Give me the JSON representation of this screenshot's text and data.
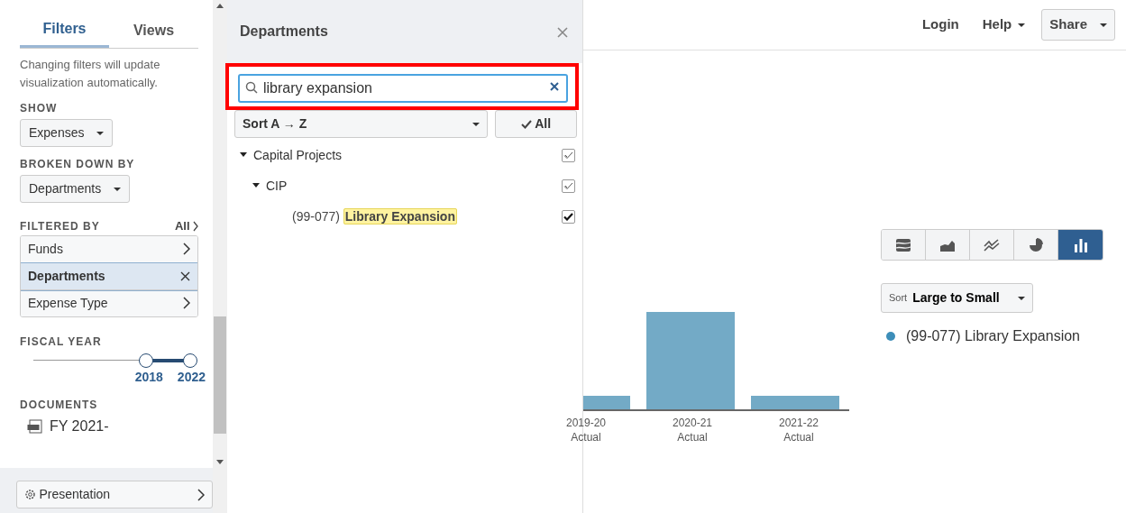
{
  "sidebar": {
    "tabs": [
      {
        "label": "Filters",
        "selected": true
      },
      {
        "label": "Views",
        "selected": false
      }
    ],
    "note": "Changing filters will update visualization automatically.",
    "show": {
      "label": "SHOW",
      "value": "Expenses"
    },
    "broken_down_by": {
      "label": "BROKEN DOWN BY",
      "value": "Departments"
    },
    "filtered_by": {
      "label": "FILTERED BY",
      "all_link": "All",
      "items": [
        {
          "label": "Funds",
          "selected": false
        },
        {
          "label": "Departments",
          "selected": true
        },
        {
          "label": "Expense Type",
          "selected": false
        }
      ]
    },
    "fiscal_year": {
      "label": "FISCAL YEAR",
      "thumbs": [
        {
          "label": "2018",
          "level": 0.72
        },
        {
          "label": "2022",
          "level": 1
        }
      ]
    },
    "documents": {
      "label": "DOCUMENTS",
      "items": [
        {
          "label": "FY 2021-"
        }
      ]
    },
    "presentation_button": "Presentation"
  },
  "panel": {
    "title": "Departments",
    "search_value": "library expansion",
    "sort": "Sort A → Z",
    "all_button": "All",
    "tree": [
      {
        "label": "Capital Projects",
        "expanded": true,
        "checked": true,
        "partial": true,
        "children": [
          {
            "label": "CIP",
            "expanded": true,
            "checked": true,
            "partial": true,
            "children": [
              {
                "code": "(99-077)",
                "highlight": "Library Expansion",
                "checked": true,
                "partial": false
              }
            ]
          }
        ]
      }
    ]
  },
  "topbar": {
    "login": "Login",
    "help": "Help",
    "share": "Share"
  },
  "chart_types": [
    {
      "kind": "stream",
      "selected": false
    },
    {
      "kind": "area",
      "selected": false
    },
    {
      "kind": "line",
      "selected": false
    },
    {
      "kind": "pie",
      "selected": false
    },
    {
      "kind": "bar",
      "selected": true
    }
  ],
  "sort": {
    "prefix": "Sort",
    "value": "Large to Small"
  },
  "legend": [
    {
      "label": "(99-077) Library Expansion",
      "color": "#3d8eb9"
    }
  ],
  "chart": {
    "labels": [
      {
        "year": "2019-20",
        "sub": "Actual"
      },
      {
        "year": "2020-21",
        "sub": "Actual"
      },
      {
        "year": "2021-22",
        "sub": "Actual"
      }
    ]
  }
}
